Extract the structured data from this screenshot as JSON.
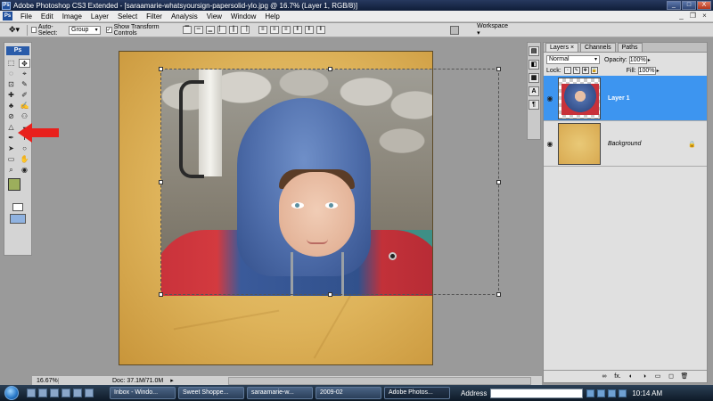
{
  "window": {
    "title": "Adobe Photoshop CS3 Extended - [saraamarie-whatsyoursign-papersolid-ylo.jpg @ 16.7% (Layer 1, RGB/8)]",
    "app_icon": "Ps",
    "controls": {
      "minimize": "_",
      "maximize": "□",
      "close": "X"
    }
  },
  "menubar": {
    "logo": "Ps",
    "items": [
      "File",
      "Edit",
      "Image",
      "Layer",
      "Select",
      "Filter",
      "Analysis",
      "View",
      "Window",
      "Help"
    ],
    "controls": {
      "minimize": "_",
      "restore": "❐",
      "close": "×"
    }
  },
  "options": {
    "tool_icon": "move-tool-icon",
    "auto_select_label": "Auto-Select:",
    "auto_select_value": "Group",
    "show_transform_label": "Show Transform Controls",
    "show_transform_checked": true,
    "workspace_label": "Workspace ▾"
  },
  "tools": {
    "badge": "Ps",
    "glyphs": [
      "⬚",
      "✥",
      "◌",
      "⌖",
      "⊡",
      "✎",
      "✚",
      "✐",
      "♣",
      "✍",
      "⊘",
      "⚇",
      "△",
      "◒",
      "✒",
      "T",
      "➤",
      "○",
      "▭",
      "✋",
      "⌕",
      "◉",
      "⚲",
      "⊕"
    ],
    "foreground_color": "#9cae5c",
    "background_color": "#3c7a45"
  },
  "annotation": {
    "arrow_color": "#e8201c"
  },
  "status": {
    "zoom": "16.67%",
    "doc": "Doc: 37.1M/71.0M",
    "arrow": "▸"
  },
  "dock": {
    "items": [
      "▤",
      "◧",
      "▦",
      "A",
      "¶"
    ]
  },
  "layers_panel": {
    "tabs": [
      "Layers ×",
      "Channels",
      "Paths"
    ],
    "blend_mode": "Normal",
    "opacity_label": "Opacity:",
    "opacity_value": "100%",
    "lock_label": "Lock:",
    "fill_label": "Fill:",
    "fill_value": "100%",
    "layers": [
      {
        "name": "Layer 1",
        "active": true,
        "visible_icon": "eye-icon"
      },
      {
        "name": "Background",
        "active": false,
        "visible_icon": "eye-icon",
        "locked": true
      }
    ],
    "footer_icons": [
      "∞",
      "fx.",
      "◐",
      "◑",
      "▭",
      "◻",
      "🗑"
    ]
  },
  "taskbar": {
    "buttons": [
      "Inbox - Windo...",
      "Sweet Shoppe...",
      "saraamarie-w...",
      "2009-02",
      "Adobe Photos..."
    ],
    "active_index": 4,
    "address_label": "Address",
    "clock": "10:14 AM"
  }
}
